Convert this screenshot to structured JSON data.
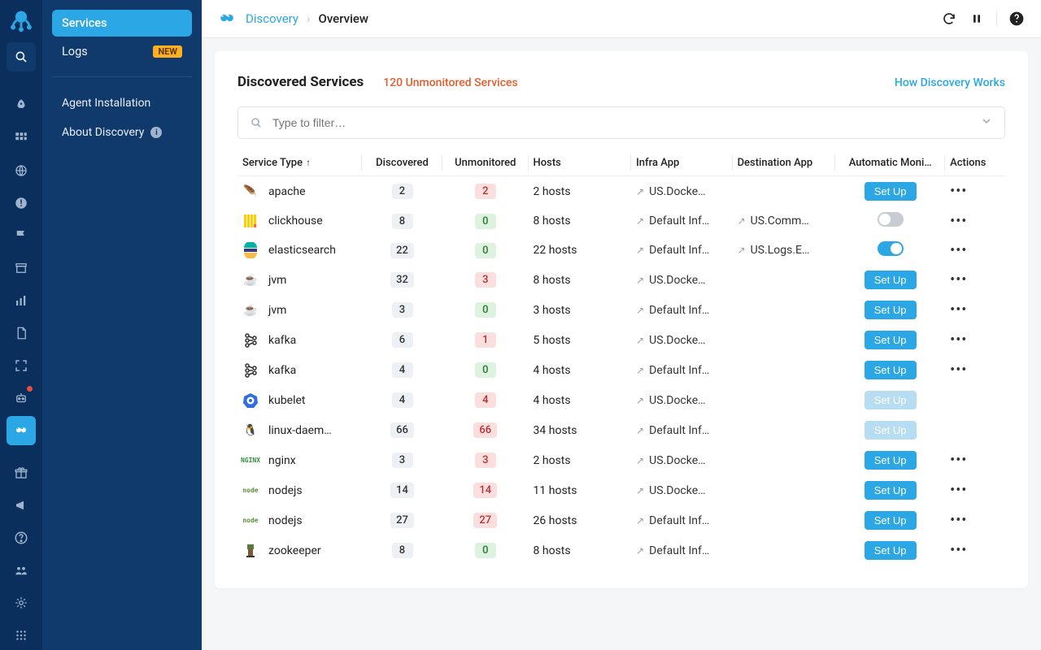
{
  "sidebar": {
    "search_icon": "search",
    "items": [
      "Services",
      "Logs"
    ],
    "new_badge": "NEW",
    "links": [
      "Agent Installation",
      "About Discovery"
    ]
  },
  "breadcrumb": {
    "root": "Discovery",
    "current": "Overview"
  },
  "header": {
    "title": "Discovered Services",
    "unmonitored_link": "120 Unmonitored Services",
    "how_link": "How Discovery Works",
    "filter_placeholder": "Type to filter…"
  },
  "columns": {
    "service": "Service Type",
    "discovered": "Discovered",
    "unmonitored": "Unmonitored",
    "hosts": "Hosts",
    "infra": "Infra App",
    "dest": "Destination App",
    "auto": "Automatic Moni…",
    "actions": "Actions"
  },
  "setup_label": "Set Up",
  "rows": [
    {
      "name": "apache",
      "disc": "2",
      "unmon": "2",
      "unmon_c": "red",
      "hosts": "2 hosts",
      "infra": "US.Docke…",
      "dest": "",
      "auto": "setup",
      "actions": true,
      "icon": "🪶",
      "ic": ""
    },
    {
      "name": "clickhouse",
      "disc": "8",
      "unmon": "0",
      "unmon_c": "green",
      "hosts": "8 hosts",
      "infra": "Default Inf…",
      "dest": "US.Comm…",
      "auto": "off",
      "actions": true,
      "icon": "",
      "ic": "ch"
    },
    {
      "name": "elasticsearch",
      "disc": "22",
      "unmon": "0",
      "unmon_c": "green",
      "hosts": "22 hosts",
      "infra": "Default Inf…",
      "dest": "US.Logs.E…",
      "auto": "on",
      "actions": true,
      "icon": "",
      "ic": "es"
    },
    {
      "name": "jvm",
      "disc": "32",
      "unmon": "3",
      "unmon_c": "red",
      "hosts": "8 hosts",
      "infra": "US.Docke…",
      "dest": "",
      "auto": "setup",
      "actions": true,
      "icon": "☕",
      "ic": ""
    },
    {
      "name": "jvm",
      "disc": "3",
      "unmon": "0",
      "unmon_c": "green",
      "hosts": "3 hosts",
      "infra": "Default Inf…",
      "dest": "",
      "auto": "setup",
      "actions": true,
      "icon": "☕",
      "ic": ""
    },
    {
      "name": "kafka",
      "disc": "6",
      "unmon": "1",
      "unmon_c": "red",
      "hosts": "5 hosts",
      "infra": "US.Docke…",
      "dest": "",
      "auto": "setup",
      "actions": true,
      "icon": "",
      "ic": "kf"
    },
    {
      "name": "kafka",
      "disc": "4",
      "unmon": "0",
      "unmon_c": "green",
      "hosts": "4 hosts",
      "infra": "Default Inf…",
      "dest": "",
      "auto": "setup",
      "actions": true,
      "icon": "",
      "ic": "kf"
    },
    {
      "name": "kubelet",
      "disc": "4",
      "unmon": "4",
      "unmon_c": "red",
      "hosts": "4 hosts",
      "infra": "US.Docke…",
      "dest": "",
      "auto": "setup-disabled",
      "actions": false,
      "icon": "",
      "ic": "kb"
    },
    {
      "name": "linux-daem…",
      "disc": "66",
      "unmon": "66",
      "unmon_c": "red",
      "hosts": "34 hosts",
      "infra": "Default Inf…",
      "dest": "",
      "auto": "setup-disabled",
      "actions": false,
      "icon": "🐧",
      "ic": ""
    },
    {
      "name": "nginx",
      "disc": "3",
      "unmon": "3",
      "unmon_c": "red",
      "hosts": "2 hosts",
      "infra": "US.Docke…",
      "dest": "",
      "auto": "setup",
      "actions": true,
      "icon": "",
      "ic": "ng"
    },
    {
      "name": "nodejs",
      "disc": "14",
      "unmon": "14",
      "unmon_c": "red",
      "hosts": "11 hosts",
      "infra": "US.Docke…",
      "dest": "",
      "auto": "setup",
      "actions": true,
      "icon": "",
      "ic": "nd"
    },
    {
      "name": "nodejs",
      "disc": "27",
      "unmon": "27",
      "unmon_c": "red",
      "hosts": "26 hosts",
      "infra": "Default Inf…",
      "dest": "",
      "auto": "setup",
      "actions": true,
      "icon": "",
      "ic": "nd"
    },
    {
      "name": "zookeeper",
      "disc": "8",
      "unmon": "0",
      "unmon_c": "green",
      "hosts": "8 hosts",
      "infra": "Default Inf…",
      "dest": "",
      "auto": "setup",
      "actions": true,
      "icon": "",
      "ic": "zk"
    }
  ]
}
